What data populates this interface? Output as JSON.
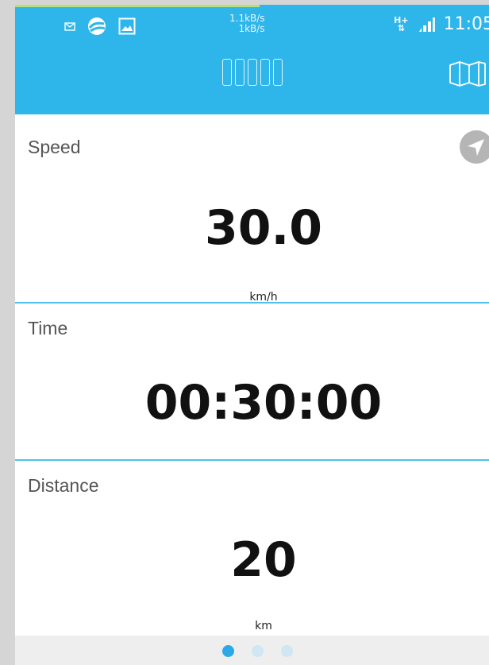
{
  "status_bar": {
    "net_up": "1.1kB/s",
    "net_down": "1kB/s",
    "network_type": "H+",
    "time": "11:05",
    "icons": [
      "mail-icon",
      "sync-icon",
      "image-icon",
      "signal-icon"
    ]
  },
  "toolbar": {
    "icons": [
      "map-icon"
    ]
  },
  "speed": {
    "label": "Speed",
    "value": "30.0",
    "unit": "km/h"
  },
  "time_panel": {
    "label": "Time",
    "value": "00:30:00"
  },
  "distance": {
    "label": "Distance",
    "value": "20",
    "unit": "km"
  },
  "pager": {
    "active_index": 0,
    "count": 3
  },
  "colors": {
    "accent": "#2eb6eb",
    "divider": "#4fc1ee",
    "dot_active": "#2aa8e8",
    "dot_inactive": "#cfe6f3"
  }
}
